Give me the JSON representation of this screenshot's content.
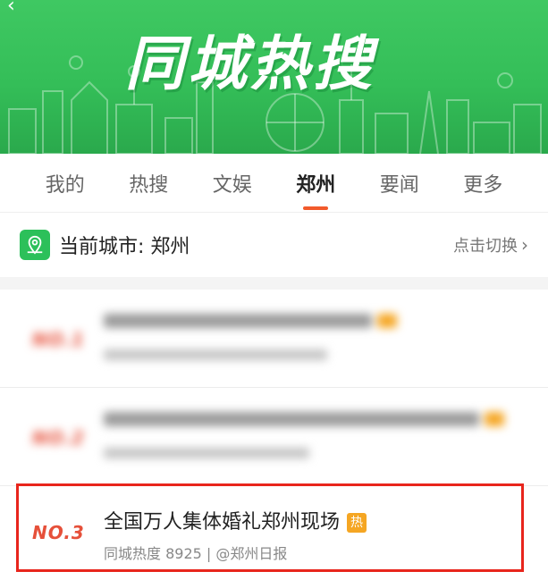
{
  "banner": {
    "title": "同城热搜",
    "back_glyph": "‹"
  },
  "tabs": [
    {
      "label": "我的",
      "active": false
    },
    {
      "label": "热搜",
      "active": false
    },
    {
      "label": "文娱",
      "active": false
    },
    {
      "label": "郑州",
      "active": true
    },
    {
      "label": "要闻",
      "active": false
    },
    {
      "label": "更多",
      "active": false
    }
  ],
  "city": {
    "label": "当前城市: 郑州",
    "switch_label": "点击切换",
    "icon": "location-pin-icon"
  },
  "items": [
    {
      "rank": "NO.1",
      "blurred": true
    },
    {
      "rank": "NO.2",
      "blurred": true
    },
    {
      "rank": "NO.3",
      "title": "全国万人集体婚礼郑州现场",
      "badge": "热",
      "meta": "同城热度 8925 | @郑州日报",
      "blurred": false
    }
  ],
  "colors": {
    "banner_green": "#34be58",
    "accent_orange": "#f25a2c",
    "rank_red": "#e6503a",
    "badge_orange": "#f5a623",
    "highlight_red": "#e8251c"
  }
}
